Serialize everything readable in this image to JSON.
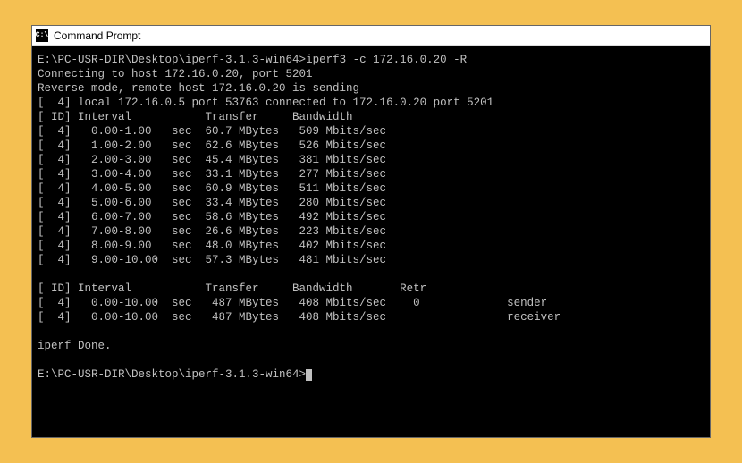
{
  "window": {
    "title": "Command Prompt",
    "icon_label": "C:\\"
  },
  "terminal": {
    "prompt1": "E:\\PC-USR-DIR\\Desktop\\iperf-3.1.3-win64>",
    "command": "iperf3 -c 172.16.0.20 -R",
    "connect_line": "Connecting to host 172.16.0.20, port 5201",
    "reverse_line": "Reverse mode, remote host 172.16.0.20 is sending",
    "local_line": "[  4] local 172.16.0.5 port 53763 connected to 172.16.0.20 port 5201",
    "header1": "[ ID] Interval           Transfer     Bandwidth",
    "rows": [
      "[  4]   0.00-1.00   sec  60.7 MBytes   509 Mbits/sec",
      "[  4]   1.00-2.00   sec  62.6 MBytes   526 Mbits/sec",
      "[  4]   2.00-3.00   sec  45.4 MBytes   381 Mbits/sec",
      "[  4]   3.00-4.00   sec  33.1 MBytes   277 Mbits/sec",
      "[  4]   4.00-5.00   sec  60.9 MBytes   511 Mbits/sec",
      "[  4]   5.00-6.00   sec  33.4 MBytes   280 Mbits/sec",
      "[  4]   6.00-7.00   sec  58.6 MBytes   492 Mbits/sec",
      "[  4]   7.00-8.00   sec  26.6 MBytes   223 Mbits/sec",
      "[  4]   8.00-9.00   sec  48.0 MBytes   402 Mbits/sec",
      "[  4]   9.00-10.00  sec  57.3 MBytes   481 Mbits/sec"
    ],
    "separator": "- - - - - - - - - - - - - - - - - - - - - - - - -",
    "header2": "[ ID] Interval           Transfer     Bandwidth       Retr",
    "summary1": "[  4]   0.00-10.00  sec   487 MBytes   408 Mbits/sec    0             sender",
    "summary2": "[  4]   0.00-10.00  sec   487 MBytes   408 Mbits/sec                  receiver",
    "done": "iperf Done.",
    "prompt2": "E:\\PC-USR-DIR\\Desktop\\iperf-3.1.3-win64>"
  }
}
